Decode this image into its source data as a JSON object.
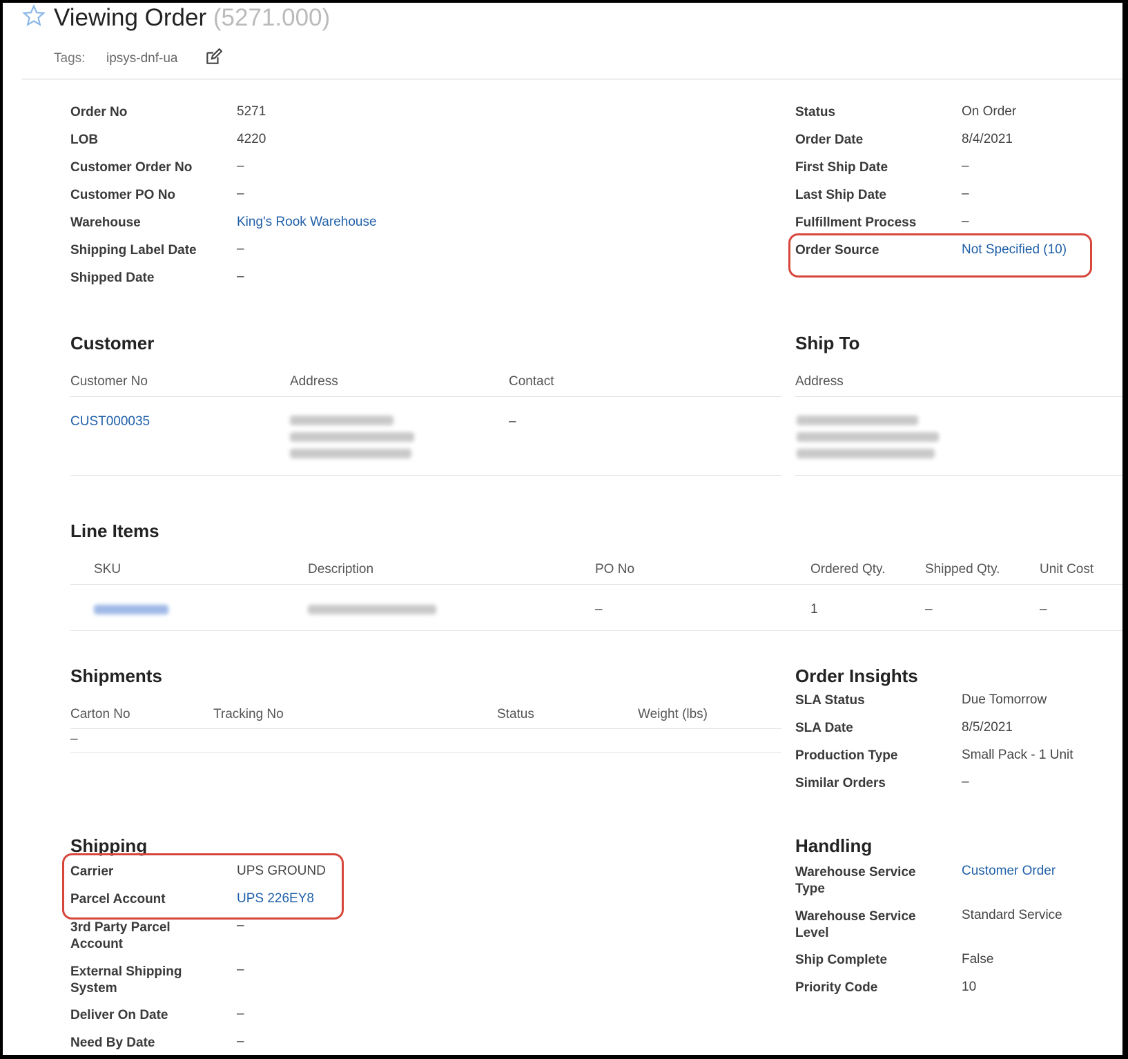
{
  "header": {
    "title": "Viewing Order",
    "subtitle": "(5271.000)",
    "tags_label": "Tags:",
    "tag_value": "ipsys-dnf-ua"
  },
  "details_left": [
    {
      "label": "Order No",
      "value": "5271"
    },
    {
      "label": "LOB",
      "value": "4220"
    },
    {
      "label": "Customer Order No",
      "value": "–"
    },
    {
      "label": "Customer PO No",
      "value": "–"
    },
    {
      "label": "Warehouse",
      "value": "King's Rook Warehouse"
    },
    {
      "label": "Shipping Label Date",
      "value": "–"
    },
    {
      "label": "Shipped Date",
      "value": "–"
    }
  ],
  "details_right": [
    {
      "label": "Status",
      "value": "On Order"
    },
    {
      "label": "Order Date",
      "value": "8/4/2021"
    },
    {
      "label": "First Ship Date",
      "value": "–"
    },
    {
      "label": "Last Ship Date",
      "value": "–"
    },
    {
      "label": "Fulfillment Process",
      "value": "–"
    },
    {
      "label": "Order Source",
      "value": "Not Specified (10)"
    }
  ],
  "customer": {
    "title": "Customer",
    "col_customer_no": "Customer No",
    "col_address": "Address",
    "col_contact": "Contact",
    "customer_no": "CUST000035",
    "contact": "–"
  },
  "ship_to": {
    "title": "Ship To",
    "col_address": "Address"
  },
  "line_items": {
    "title": "Line Items",
    "col_sku": "SKU",
    "col_description": "Description",
    "col_po_no": "PO No",
    "col_ordered_qty": "Ordered Qty.",
    "col_shipped_qty": "Shipped Qty.",
    "col_unit_cost": "Unit Cost",
    "row": {
      "po_no": "–",
      "ordered_qty": "1",
      "shipped_qty": "–",
      "unit_cost": "–"
    }
  },
  "shipments": {
    "title": "Shipments",
    "col_carton_no": "Carton No",
    "col_tracking_no": "Tracking No",
    "col_status": "Status",
    "col_weight": "Weight (lbs)",
    "empty": "–"
  },
  "order_insights": {
    "title": "Order Insights",
    "rows": [
      {
        "label": "SLA Status",
        "value": "Due Tomorrow"
      },
      {
        "label": "SLA Date",
        "value": "8/5/2021"
      },
      {
        "label": "Production Type",
        "value": "Small Pack - 1 Unit"
      },
      {
        "label": "Similar Orders",
        "value": "–"
      }
    ]
  },
  "shipping": {
    "title": "Shipping",
    "rows": [
      {
        "label": "Carrier",
        "value": "UPS GROUND"
      },
      {
        "label": "Parcel Account",
        "value": "UPS 226EY8"
      },
      {
        "label_1": "3rd Party Parcel",
        "label_2": "Account",
        "value": "–"
      },
      {
        "label_1": "External Shipping",
        "label_2": "System",
        "value": "–"
      },
      {
        "label": "Deliver On Date",
        "value": "–"
      },
      {
        "label": "Need By Date",
        "value": "–"
      }
    ]
  },
  "handling": {
    "title": "Handling",
    "rows": [
      {
        "label_1": "Warehouse Service",
        "label_2": "Type",
        "value": "Customer Order"
      },
      {
        "label_1": "Warehouse Service",
        "label_2": "Level",
        "value": "Standard Service"
      },
      {
        "label": "Ship Complete",
        "value": "False"
      },
      {
        "label": "Priority Code",
        "value": "10"
      }
    ]
  },
  "colors": {
    "link": "#1f5fa8",
    "highlight": "#d6463b",
    "star": "#8ab8e8"
  },
  "icons": [
    "star-icon",
    "edit-icon"
  ]
}
